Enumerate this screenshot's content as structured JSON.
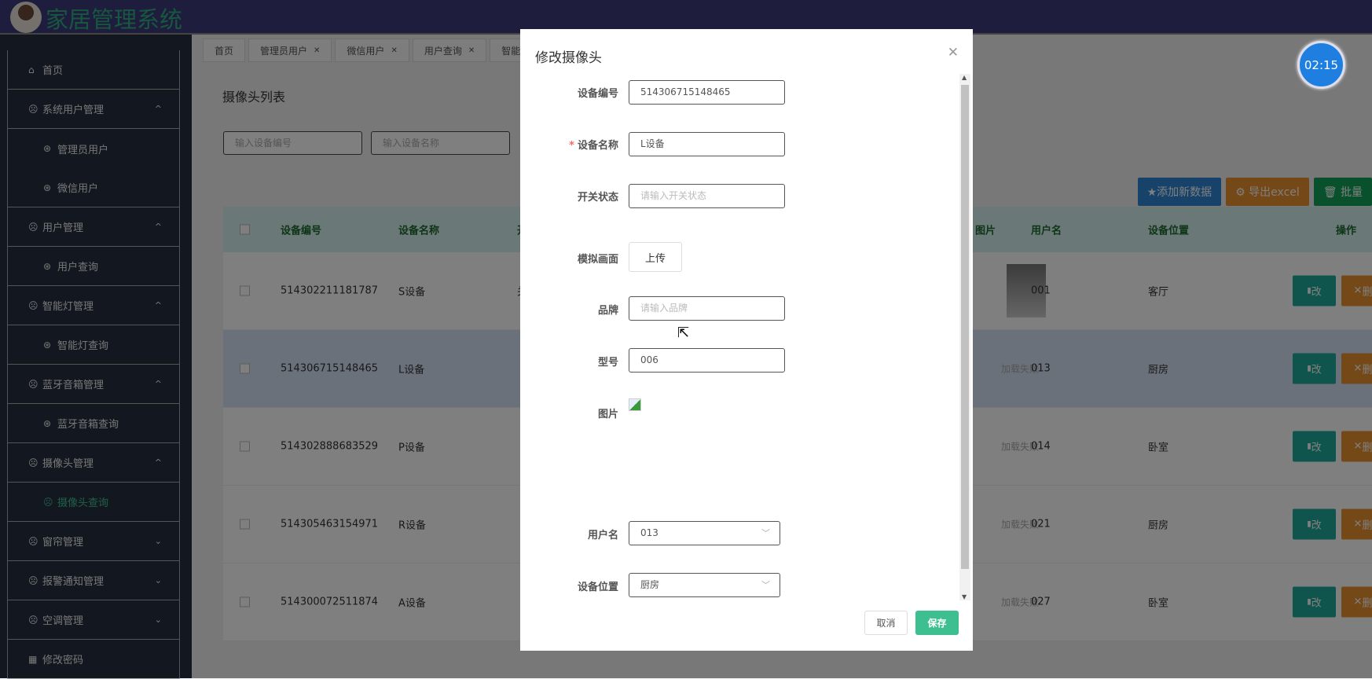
{
  "header": {
    "title": "家居管理系统"
  },
  "sidebar": {
    "items": [
      {
        "label": "首页",
        "icon": "home-icon",
        "type": "top"
      },
      {
        "label": "系统用户管理",
        "icon": "face-icon",
        "type": "group",
        "expanded": true
      },
      {
        "label": "管理员用户",
        "icon": "ball-icon",
        "type": "sub"
      },
      {
        "label": "微信用户",
        "icon": "ball-icon",
        "type": "sub",
        "last": true
      },
      {
        "label": "用户管理",
        "icon": "face-icon",
        "type": "group",
        "expanded": true
      },
      {
        "label": "用户查询",
        "icon": "ball-icon",
        "type": "sub",
        "last": true
      },
      {
        "label": "智能灯管理",
        "icon": "face-icon",
        "type": "group",
        "expanded": true
      },
      {
        "label": "智能灯查询",
        "icon": "ball-icon",
        "type": "sub",
        "last": true
      },
      {
        "label": "蓝牙音箱管理",
        "icon": "face-icon",
        "type": "group",
        "expanded": true
      },
      {
        "label": "蓝牙音箱查询",
        "icon": "ball-icon",
        "type": "sub",
        "last": true
      },
      {
        "label": "摄像头管理",
        "icon": "face-icon",
        "type": "group",
        "expanded": true
      },
      {
        "label": "摄像头查询",
        "icon": "face-icon",
        "type": "sub",
        "last": true,
        "active": true
      },
      {
        "label": "窗帘管理",
        "icon": "face-icon",
        "type": "group",
        "expanded": false
      },
      {
        "label": "报警通知管理",
        "icon": "face-icon",
        "type": "group",
        "expanded": false
      },
      {
        "label": "空调管理",
        "icon": "face-icon",
        "type": "group",
        "expanded": false
      },
      {
        "label": "修改密码",
        "icon": "grid-icon",
        "type": "top"
      }
    ]
  },
  "tabs": [
    {
      "label": "首页",
      "closable": false
    },
    {
      "label": "管理员用户",
      "closable": true
    },
    {
      "label": "微信用户",
      "closable": true
    },
    {
      "label": "用户查询",
      "closable": true
    },
    {
      "label": "智能",
      "closable": false
    }
  ],
  "main": {
    "title": "摄像头列表",
    "search": [
      {
        "placeholder": "输入设备编号"
      },
      {
        "placeholder": "输入设备名称"
      }
    ],
    "toolbar": [
      {
        "label": "★添加新数据",
        "color": "#2e86d6"
      },
      {
        "label": "⚙ 导出excel",
        "color": "#e8902e"
      },
      {
        "label": "🗑 批量",
        "color": "#12a35a"
      }
    ],
    "columns": [
      "设备编号",
      "设备名称",
      "开",
      "图片",
      "用户名",
      "设备位置",
      "操作"
    ],
    "rows": [
      {
        "id": "514302211181787",
        "name": "S设备",
        "state": "关",
        "image": "thumb",
        "user": "001",
        "location": "客厅"
      },
      {
        "id": "514306715148465",
        "name": "L设备",
        "state": "",
        "image": "加载失败",
        "user": "013",
        "location": "厨房",
        "selected": true
      },
      {
        "id": "514302888683529",
        "name": "P设备",
        "state": "",
        "image": "加载失败",
        "user": "014",
        "location": "卧室"
      },
      {
        "id": "514305463154971",
        "name": "R设备",
        "state": "",
        "image": "加载失败",
        "user": "021",
        "location": "厨房"
      },
      {
        "id": "514300072511874",
        "name": "A设备",
        "state": "",
        "image": "加载失败",
        "user": "027",
        "location": "卧室"
      }
    ],
    "edit_label": "改",
    "delete_label": "删"
  },
  "timer": "02:15",
  "modal": {
    "title": "修改摄像头",
    "fields": {
      "device_no": {
        "label": "设备编号",
        "value": "514306715148465"
      },
      "device_name": {
        "label": "设备名称",
        "value": "L设备",
        "required": "*"
      },
      "switch_state": {
        "label": "开关状态",
        "placeholder": "请输入开关状态"
      },
      "sim_image": {
        "label": "模拟画面",
        "button": "上传"
      },
      "brand": {
        "label": "品牌",
        "placeholder": "请输入品牌"
      },
      "model": {
        "label": "型号",
        "value": "006"
      },
      "picture": {
        "label": "图片"
      },
      "username": {
        "label": "用户名",
        "value": "013"
      },
      "location": {
        "label": "设备位置",
        "value": "厨房"
      }
    },
    "cancel": "取消",
    "save": "保存"
  }
}
